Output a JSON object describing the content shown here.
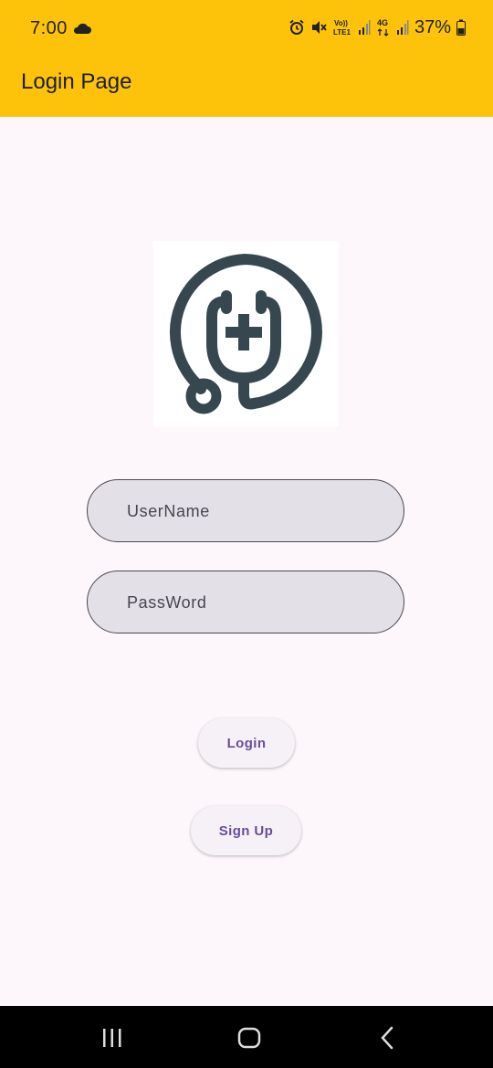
{
  "status_bar": {
    "time": "7:00",
    "battery_percent": "37%",
    "network_label_top": "Vo))",
    "network_label_bottom": "LTE1",
    "network_type": "4G",
    "icons": [
      "cloud-icon",
      "alarm-icon",
      "mute-icon",
      "volte-icon",
      "signal-icon",
      "4g-icon",
      "signal-icon",
      "battery-icon"
    ]
  },
  "app_bar": {
    "title": "Login Page"
  },
  "logo": {
    "icon": "stethoscope-medical-cross-icon",
    "color": "#37474f"
  },
  "form": {
    "username_placeholder": "UserName",
    "username_value": "",
    "password_placeholder": "PassWord",
    "password_value": ""
  },
  "buttons": {
    "login_label": "Login",
    "signup_label": "Sign Up"
  },
  "colors": {
    "app_bar": "#fdc20a",
    "background": "#fdf7fc",
    "button_text": "#6a4c9c",
    "field_fill": "#e4e0e7"
  },
  "nav_bar": {
    "icons": [
      "recents-icon",
      "home-icon",
      "back-icon"
    ]
  }
}
